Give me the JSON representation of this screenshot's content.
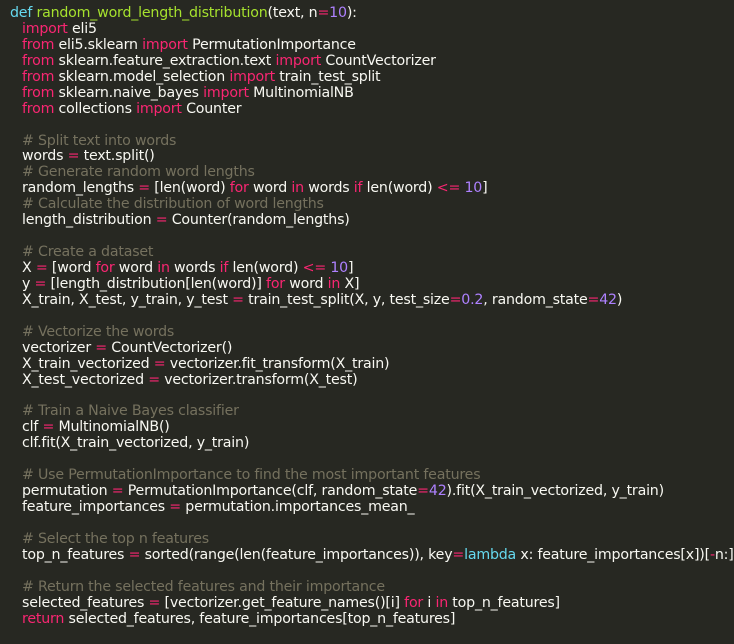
{
  "editor": {
    "background": "#272822",
    "colors": {
      "text": "#f8f8f2",
      "keyword": "#f92672",
      "function_name": "#a6e22e",
      "number": "#ae81ff",
      "comment": "#75715e",
      "def": "#66d9ef"
    },
    "lines": [
      {
        "indent": 0,
        "tokens": [
          {
            "t": "def",
            "c": "def"
          },
          {
            "t": " "
          },
          {
            "t": "random_word_length_distribution",
            "c": "fn"
          },
          {
            "t": "(text, n"
          },
          {
            "t": "=",
            "c": "kw"
          },
          {
            "t": "10",
            "c": "num"
          },
          {
            "t": "):"
          }
        ]
      },
      {
        "indent": 1,
        "tokens": [
          {
            "t": "import",
            "c": "kw"
          },
          {
            "t": " eli5"
          }
        ]
      },
      {
        "indent": 1,
        "tokens": [
          {
            "t": "from",
            "c": "kw"
          },
          {
            "t": " eli5.sklearn "
          },
          {
            "t": "import",
            "c": "kw"
          },
          {
            "t": " PermutationImportance"
          }
        ]
      },
      {
        "indent": 1,
        "tokens": [
          {
            "t": "from",
            "c": "kw"
          },
          {
            "t": " sklearn.feature_extraction.text "
          },
          {
            "t": "import",
            "c": "kw"
          },
          {
            "t": " CountVectorizer"
          }
        ]
      },
      {
        "indent": 1,
        "tokens": [
          {
            "t": "from",
            "c": "kw"
          },
          {
            "t": " sklearn.model_selection "
          },
          {
            "t": "import",
            "c": "kw"
          },
          {
            "t": " train_test_split"
          }
        ]
      },
      {
        "indent": 1,
        "tokens": [
          {
            "t": "from",
            "c": "kw"
          },
          {
            "t": " sklearn.naive_bayes "
          },
          {
            "t": "import",
            "c": "kw"
          },
          {
            "t": " MultinomialNB"
          }
        ]
      },
      {
        "indent": 1,
        "tokens": [
          {
            "t": "from",
            "c": "kw"
          },
          {
            "t": " collections "
          },
          {
            "t": "import",
            "c": "kw"
          },
          {
            "t": " Counter"
          }
        ]
      },
      {
        "indent": 0,
        "tokens": []
      },
      {
        "indent": 1,
        "tokens": [
          {
            "t": "# Split text into words",
            "c": "cm"
          }
        ]
      },
      {
        "indent": 1,
        "tokens": [
          {
            "t": "words "
          },
          {
            "t": "=",
            "c": "kw"
          },
          {
            "t": " text.split()"
          }
        ]
      },
      {
        "indent": 1,
        "tokens": [
          {
            "t": "# Generate random word lengths",
            "c": "cm"
          }
        ]
      },
      {
        "indent": 1,
        "tokens": [
          {
            "t": "random_lengths "
          },
          {
            "t": "=",
            "c": "kw"
          },
          {
            "t": " [len(word) "
          },
          {
            "t": "for",
            "c": "kw"
          },
          {
            "t": " word "
          },
          {
            "t": "in",
            "c": "kw"
          },
          {
            "t": " words "
          },
          {
            "t": "if",
            "c": "kw"
          },
          {
            "t": " len(word) "
          },
          {
            "t": "<=",
            "c": "kw"
          },
          {
            "t": " "
          },
          {
            "t": "10",
            "c": "num"
          },
          {
            "t": "]"
          }
        ]
      },
      {
        "indent": 1,
        "tokens": [
          {
            "t": "# Calculate the distribution of word lengths",
            "c": "cm"
          }
        ]
      },
      {
        "indent": 1,
        "tokens": [
          {
            "t": "length_distribution "
          },
          {
            "t": "=",
            "c": "kw"
          },
          {
            "t": " Counter(random_lengths)"
          }
        ]
      },
      {
        "indent": 0,
        "tokens": []
      },
      {
        "indent": 1,
        "tokens": [
          {
            "t": "# Create a dataset",
            "c": "cm"
          }
        ]
      },
      {
        "indent": 1,
        "tokens": [
          {
            "t": "X "
          },
          {
            "t": "=",
            "c": "kw"
          },
          {
            "t": " [word "
          },
          {
            "t": "for",
            "c": "kw"
          },
          {
            "t": " word "
          },
          {
            "t": "in",
            "c": "kw"
          },
          {
            "t": " words "
          },
          {
            "t": "if",
            "c": "kw"
          },
          {
            "t": " len(word) "
          },
          {
            "t": "<=",
            "c": "kw"
          },
          {
            "t": " "
          },
          {
            "t": "10",
            "c": "num"
          },
          {
            "t": "]"
          }
        ]
      },
      {
        "indent": 1,
        "tokens": [
          {
            "t": "y "
          },
          {
            "t": "=",
            "c": "kw"
          },
          {
            "t": " [length_distribution[len(word)] "
          },
          {
            "t": "for",
            "c": "kw"
          },
          {
            "t": " word "
          },
          {
            "t": "in",
            "c": "kw"
          },
          {
            "t": " X]"
          }
        ]
      },
      {
        "indent": 1,
        "tokens": [
          {
            "t": "X_train, X_test, y_train, y_test "
          },
          {
            "t": "=",
            "c": "kw"
          },
          {
            "t": " train_test_split(X, y, test_size"
          },
          {
            "t": "=",
            "c": "kw"
          },
          {
            "t": "0.2",
            "c": "num"
          },
          {
            "t": ", random_state"
          },
          {
            "t": "=",
            "c": "kw"
          },
          {
            "t": "42",
            "c": "num"
          },
          {
            "t": ")"
          }
        ]
      },
      {
        "indent": 0,
        "tokens": []
      },
      {
        "indent": 1,
        "tokens": [
          {
            "t": "# Vectorize the words",
            "c": "cm"
          }
        ]
      },
      {
        "indent": 1,
        "tokens": [
          {
            "t": "vectorizer "
          },
          {
            "t": "=",
            "c": "kw"
          },
          {
            "t": " CountVectorizer()"
          }
        ]
      },
      {
        "indent": 1,
        "tokens": [
          {
            "t": "X_train_vectorized "
          },
          {
            "t": "=",
            "c": "kw"
          },
          {
            "t": " vectorizer.fit_transform(X_train)"
          }
        ]
      },
      {
        "indent": 1,
        "tokens": [
          {
            "t": "X_test_vectorized "
          },
          {
            "t": "=",
            "c": "kw"
          },
          {
            "t": " vectorizer.transform(X_test)"
          }
        ]
      },
      {
        "indent": 0,
        "tokens": []
      },
      {
        "indent": 1,
        "tokens": [
          {
            "t": "# Train a Naive Bayes classifier",
            "c": "cm"
          }
        ]
      },
      {
        "indent": 1,
        "tokens": [
          {
            "t": "clf "
          },
          {
            "t": "=",
            "c": "kw"
          },
          {
            "t": " MultinomialNB()"
          }
        ]
      },
      {
        "indent": 1,
        "tokens": [
          {
            "t": "clf.fit(X_train_vectorized, y_train)"
          }
        ]
      },
      {
        "indent": 0,
        "tokens": []
      },
      {
        "indent": 1,
        "tokens": [
          {
            "t": "# Use PermutationImportance to find the most important features",
            "c": "cm"
          }
        ]
      },
      {
        "indent": 1,
        "tokens": [
          {
            "t": "permutation "
          },
          {
            "t": "=",
            "c": "kw"
          },
          {
            "t": " PermutationImportance(clf, random_state"
          },
          {
            "t": "=",
            "c": "kw"
          },
          {
            "t": "42",
            "c": "num"
          },
          {
            "t": ").fit(X_train_vectorized, y_train)"
          }
        ]
      },
      {
        "indent": 1,
        "tokens": [
          {
            "t": "feature_importances "
          },
          {
            "t": "=",
            "c": "kw"
          },
          {
            "t": " permutation.importances_mean_"
          }
        ]
      },
      {
        "indent": 0,
        "tokens": []
      },
      {
        "indent": 1,
        "tokens": [
          {
            "t": "# Select the top n features",
            "c": "cm"
          }
        ]
      },
      {
        "indent": 1,
        "tokens": [
          {
            "t": "top_n_features "
          },
          {
            "t": "=",
            "c": "kw"
          },
          {
            "t": " sorted(range(len(feature_importances)), key"
          },
          {
            "t": "=",
            "c": "kw"
          },
          {
            "t": "lambda",
            "c": "def"
          },
          {
            "t": " x: feature_importances[x])["
          },
          {
            "t": "-",
            "c": "kw"
          },
          {
            "t": "n:]"
          }
        ]
      },
      {
        "indent": 0,
        "tokens": []
      },
      {
        "indent": 1,
        "tokens": [
          {
            "t": "# Return the selected features and their importance",
            "c": "cm"
          }
        ]
      },
      {
        "indent": 1,
        "tokens": [
          {
            "t": "selected_features "
          },
          {
            "t": "=",
            "c": "kw"
          },
          {
            "t": " [vectorizer.get_feature_names()[i] "
          },
          {
            "t": "for",
            "c": "kw"
          },
          {
            "t": " i "
          },
          {
            "t": "in",
            "c": "kw"
          },
          {
            "t": " top_n_features]"
          }
        ]
      },
      {
        "indent": 1,
        "tokens": [
          {
            "t": "return",
            "c": "kw"
          },
          {
            "t": " selected_features, feature_importances[top_n_features]"
          }
        ]
      }
    ]
  }
}
